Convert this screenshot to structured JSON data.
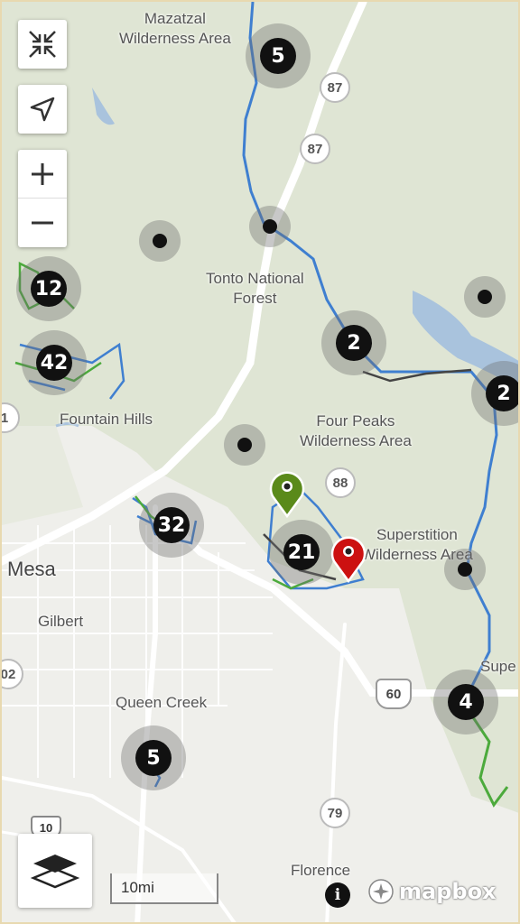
{
  "places": {
    "mazatzal": "Mazatzal\nWilderness Area",
    "tonto": "Tonto National\nForest",
    "four_peaks": "Four Peaks\nWilderness Area",
    "superstition": "Superstition\nWilderness Area",
    "fountain_hills": "Fountain Hills",
    "mesa": "Mesa",
    "gilbert": "Gilbert",
    "queen_creek": "Queen Creek",
    "florence": "Florence",
    "supe": "Supe"
  },
  "shields": {
    "r87a": "87",
    "r87b": "87",
    "r88": "88",
    "r60": "60",
    "r79": "79",
    "r10": "10",
    "r02": "02",
    "r1": "1"
  },
  "clusters": {
    "c1": "5",
    "c2": "12",
    "c3": "42",
    "c4": "2",
    "c5": "2",
    "c6": "32",
    "c7": "21",
    "c8": "4",
    "c9": "5"
  },
  "scale_label": "10mi",
  "attribution": {
    "brand": "mapbox",
    "info": "i"
  },
  "colors": {
    "trail_blue": "#3f7fd0",
    "trail_green": "#4caa3c",
    "trail_dark": "#444444",
    "pin_green": "#5a8a1a",
    "pin_red": "#cc1111",
    "forest": "#dde4d2"
  }
}
